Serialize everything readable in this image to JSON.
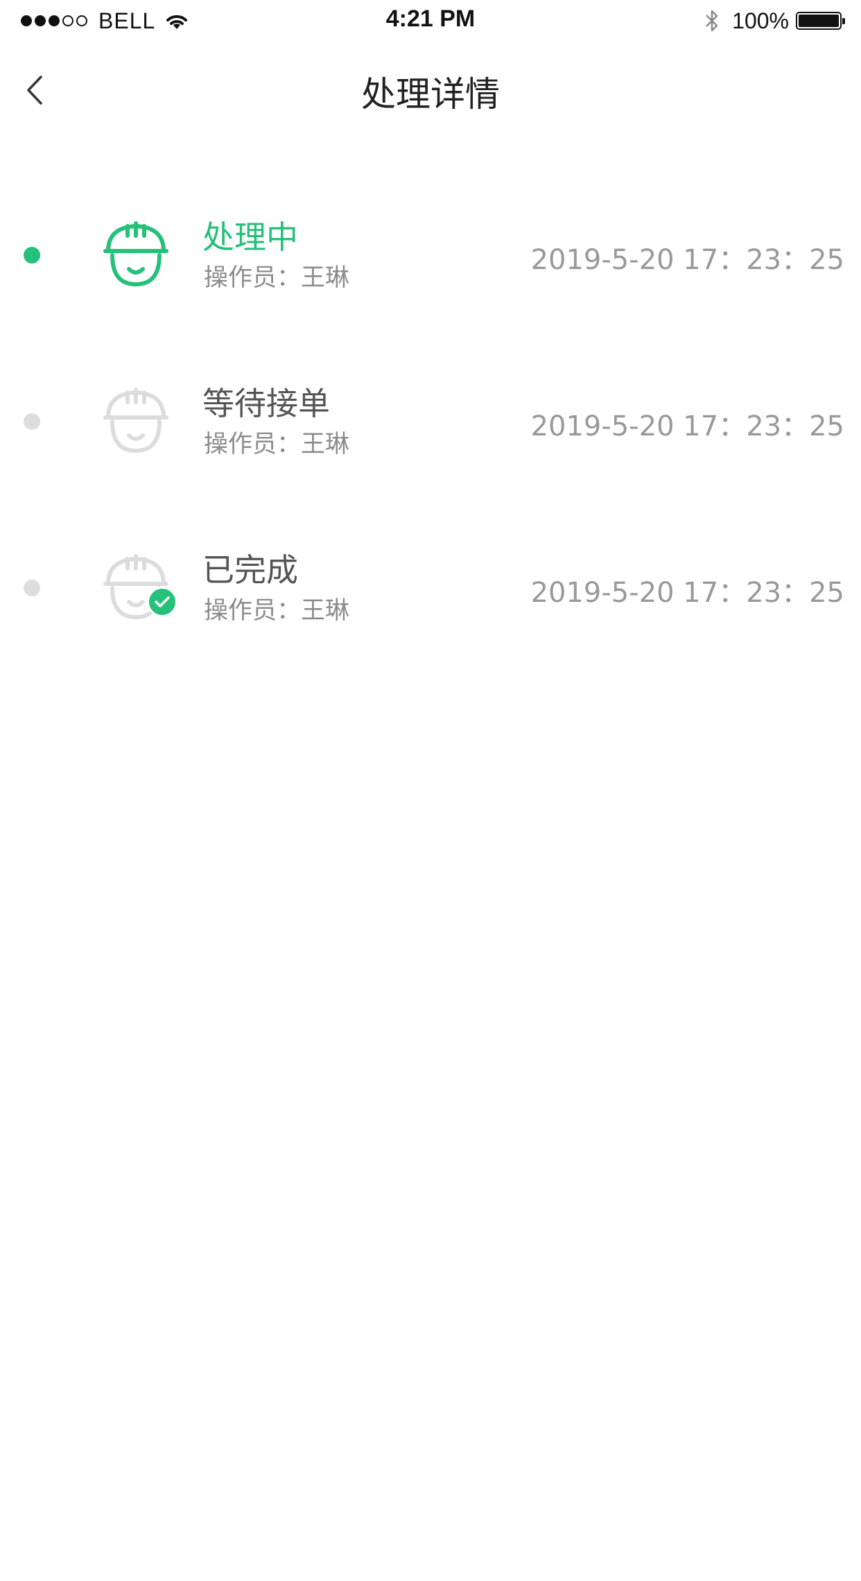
{
  "status_bar": {
    "carrier": "BELL",
    "time": "4:21 PM",
    "battery": "100%",
    "battery_level": 1.0,
    "signal_bars_filled": 3,
    "signal_bars_total": 5
  },
  "nav": {
    "title": "处理详情",
    "back_icon": "chevron-left-icon"
  },
  "colors": {
    "accent": "#25c07a",
    "inactive": "#dddddd",
    "secondary_text": "#999999"
  },
  "timeline": [
    {
      "title": "处理中",
      "operator": "操作员：王琳",
      "time": "2019-5-20 17：23：25",
      "state": "active",
      "icon": "worker-helmet-icon"
    },
    {
      "title": "等待接单",
      "operator": "操作员：王琳",
      "time": "2019-5-20 17：23：25",
      "state": "inactive",
      "icon": "worker-helmet-icon"
    },
    {
      "title": "已完成",
      "operator": "操作员：王琳",
      "time": "2019-5-20 17：23：25",
      "state": "inactive",
      "icon": "worker-helmet-check-icon"
    }
  ]
}
